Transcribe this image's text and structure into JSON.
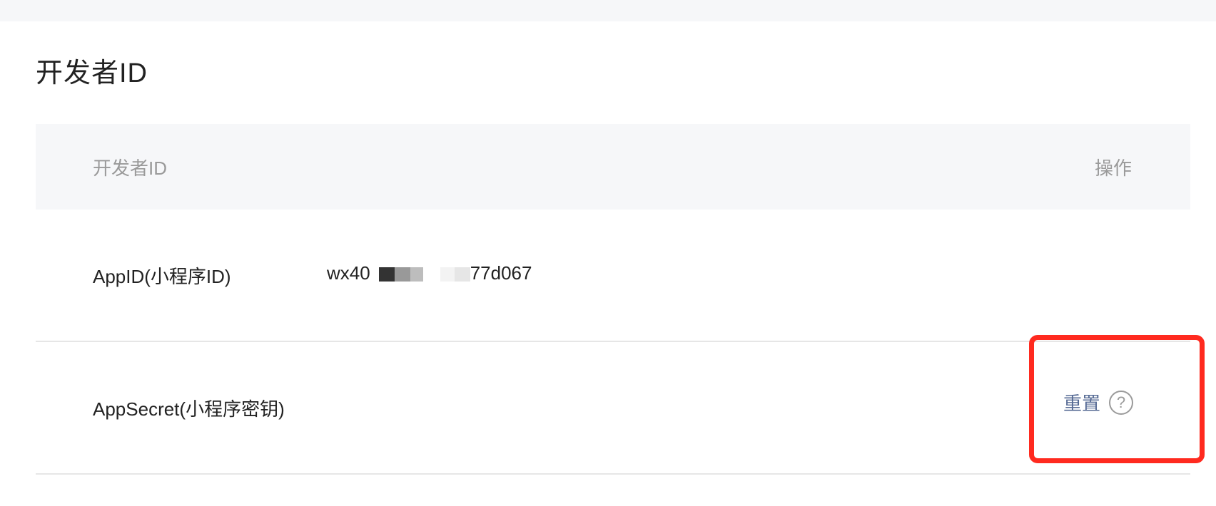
{
  "page": {
    "title": "开发者ID"
  },
  "table": {
    "headers": {
      "id": "开发者ID",
      "operation": "操作"
    },
    "rows": [
      {
        "label": "AppID(小程序ID)",
        "value_prefix": "wx40",
        "value_suffix": "77d067"
      },
      {
        "label": "AppSecret(小程序密钥)",
        "action_label": "重置",
        "help_glyph": "?"
      }
    ]
  },
  "icons": {
    "help": "question-circle-icon"
  },
  "colors": {
    "link": "#576b95",
    "highlight": "#ff2a1f",
    "header_bg": "#f6f7f9"
  }
}
